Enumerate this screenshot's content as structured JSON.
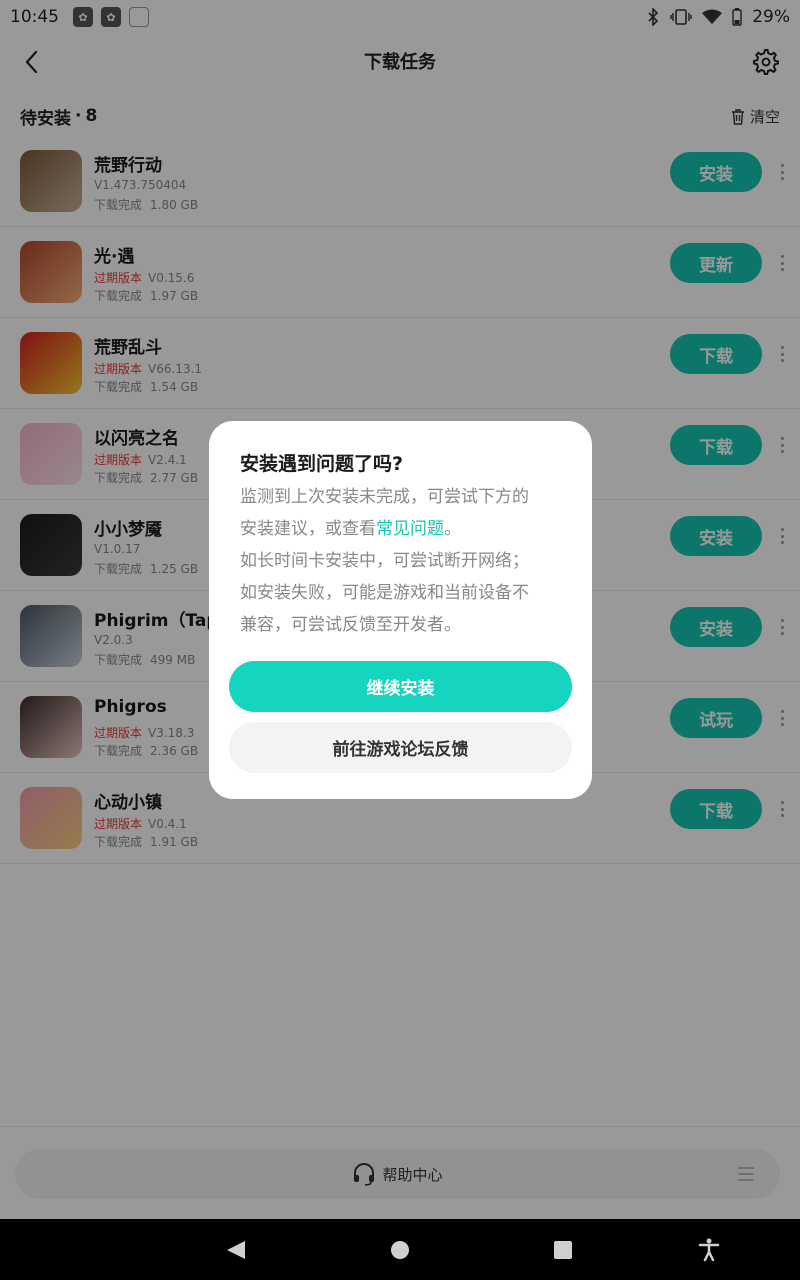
{
  "status_bar": {
    "time": "10:45",
    "battery": "29%",
    "icons": [
      "notification-icon",
      "notification-icon",
      "notification-icon",
      "bluetooth-icon",
      "vibrate-icon",
      "wifi-icon",
      "battery-icon"
    ]
  },
  "header": {
    "title": "下载任务",
    "back_icon": "back-arrow-icon",
    "settings_icon": "gear-icon"
  },
  "section": {
    "title": "待安装",
    "separator": "·",
    "count": "8",
    "clear_label": "清空",
    "clear_icon": "trash-icon"
  },
  "items": [
    {
      "name": "荒野行动",
      "expired": "",
      "version": "V1.473.750404",
      "status": "下载完成",
      "size": "1.80 GB",
      "action": "安装",
      "icon_colors": [
        "#7a5a3a",
        "#c7b199"
      ]
    },
    {
      "name": "光·遇",
      "expired": "过期版本",
      "version": "V0.15.6",
      "status": "下载完成",
      "size": "1.97 GB",
      "action": "更新",
      "icon_colors": [
        "#b3452d",
        "#f2b07a"
      ]
    },
    {
      "name": "荒野乱斗",
      "expired": "过期版本",
      "version": "V66.13.1",
      "status": "下载完成",
      "size": "1.54 GB",
      "action": "下载",
      "icon_colors": [
        "#d32020",
        "#f5c531"
      ]
    },
    {
      "name": "以闪亮之名",
      "expired": "过期版本",
      "version": "V2.4.1",
      "status": "下载完成",
      "size": "2.77 GB",
      "action": "下载",
      "icon_colors": [
        "#f6b2c6",
        "#fbe3ea"
      ]
    },
    {
      "name": "小小梦魇",
      "expired": "",
      "version": "V1.0.17",
      "status": "下载完成",
      "size": "1.25 GB",
      "action": "安装",
      "icon_colors": [
        "#1a1a1a",
        "#3a3a3a"
      ]
    },
    {
      "name": "Phigrim（TapTap）",
      "expired": "",
      "version": "V2.0.3",
      "status": "下载完成",
      "size": "499 MB",
      "action": "安装",
      "icon_colors": [
        "#4d5766",
        "#c9d1dc"
      ]
    },
    {
      "name": "Phigros",
      "expired": "过期版本",
      "version": "V3.18.3",
      "status": "下载完成",
      "size": "2.36 GB",
      "action": "试玩",
      "icon_colors": [
        "#3b2a2a",
        "#e6c7c0"
      ]
    },
    {
      "name": "心动小镇",
      "expired": "过期版本",
      "version": "V0.4.1",
      "status": "下载完成",
      "size": "1.91 GB",
      "action": "下载",
      "icon_colors": [
        "#f39ab5",
        "#f7d17a"
      ]
    }
  ],
  "bottom": {
    "help_label": "帮助中心",
    "help_icon": "headset-icon",
    "menu_icon": "menu-icon"
  },
  "dialog": {
    "title": "安装遇到问题了吗?",
    "line1": "监测到上次安装未完成，可尝试下方的",
    "line2_prefix": "安装建议，或查看",
    "line2_link": "常见问题",
    "line2_suffix": "。",
    "line3": "如长时间卡安装中，可尝试断开网络；",
    "line4": "如安装失败，可能是游戏和当前设备不",
    "line5": "兼容，可尝试反馈至开发者。",
    "primary_button": "继续安装",
    "secondary_button": "前往游戏论坛反馈"
  },
  "nav": {
    "back": "nav-back-icon",
    "home": "nav-home-icon",
    "recents": "nav-recents-icon",
    "accessibility": "accessibility-icon"
  },
  "colors": {
    "accent": "#15c5b1",
    "accent_bright": "#15d5c1",
    "expired": "#e53935"
  }
}
